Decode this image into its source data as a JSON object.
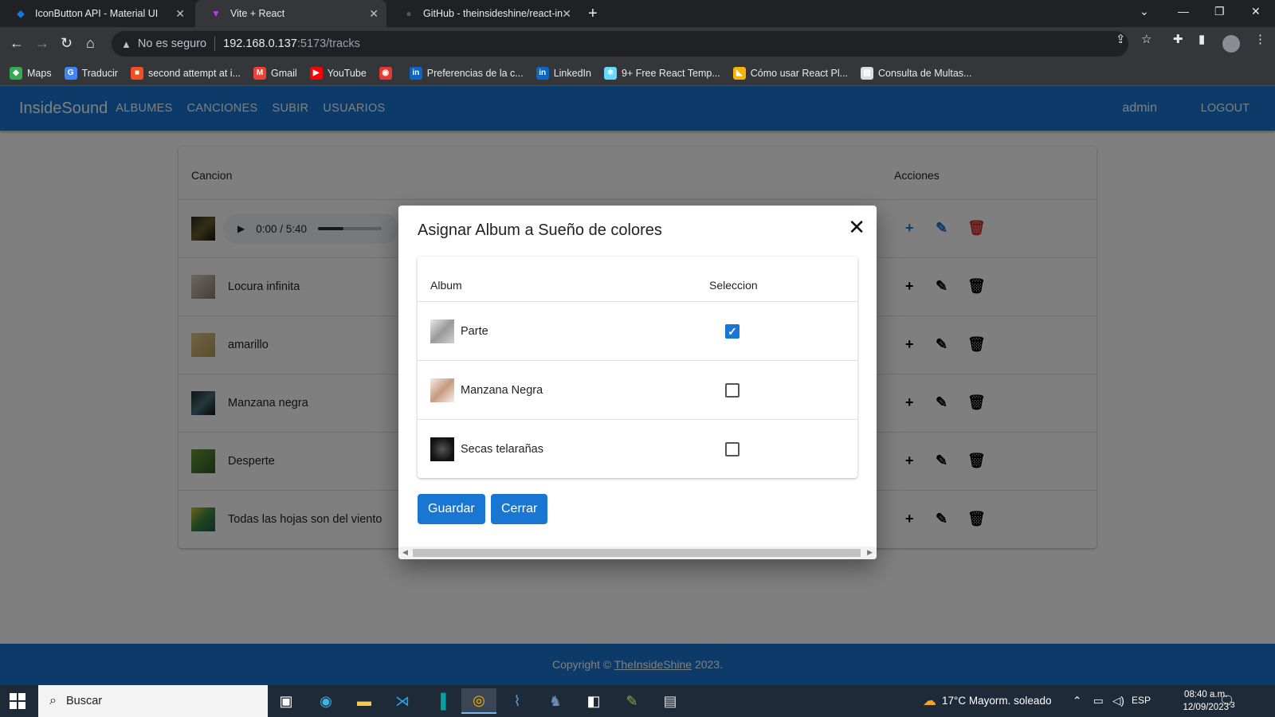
{
  "browser": {
    "tabs": [
      {
        "title": "IconButton API - Material UI",
        "icon": "mui-icon",
        "active": false
      },
      {
        "title": "Vite + React",
        "icon": "vite-icon",
        "active": true
      },
      {
        "title": "GitHub - theinsideshine/react-ins",
        "icon": "github-icon",
        "active": false
      }
    ],
    "address": {
      "warning": "No es seguro",
      "host": "192.168.0.137",
      "path": ":5173/tracks"
    },
    "bookmarks": [
      {
        "label": "Maps",
        "icon": "maps-icon",
        "color": "#34a853"
      },
      {
        "label": "Traducir",
        "icon": "translate-icon",
        "color": "#4285f4"
      },
      {
        "label": "second attempt at i...",
        "icon": "microsoft-icon",
        "color": "#f25022"
      },
      {
        "label": "Gmail",
        "icon": "gmail-icon",
        "color": "#ea4335"
      },
      {
        "label": "YouTube",
        "icon": "youtube-icon",
        "color": "#ff0000"
      },
      {
        "label": "",
        "icon": "record-icon",
        "color": "#e53935"
      },
      {
        "label": "Preferencias de la c...",
        "icon": "linkedin-icon",
        "color": "#0a66c2"
      },
      {
        "label": "LinkedIn",
        "icon": "linkedin-icon",
        "color": "#0a66c2"
      },
      {
        "label": "9+ Free React Temp...",
        "icon": "react-icon",
        "color": "#61dafb"
      },
      {
        "label": "Cómo usar React Pl...",
        "icon": "cat-icon",
        "color": "#f4b400"
      },
      {
        "label": "Consulta de Multas...",
        "icon": "document-icon",
        "color": "#dddddd"
      }
    ]
  },
  "app": {
    "brand": "InsideSound",
    "nav": [
      "ALBUMES",
      "CANCIONES",
      "SUBIR",
      "USUARIOS"
    ],
    "user": "admin",
    "logout": "LOGOUT",
    "table": {
      "headers": {
        "song": "Cancion",
        "actions": "Acciones"
      },
      "audio_time": "0:00 / 5:40",
      "rows": [
        {
          "name": "Locura infinita"
        },
        {
          "name": "amarillo"
        },
        {
          "name": "Manzana negra"
        },
        {
          "name": "Desperte"
        },
        {
          "name": "Todas las hojas son del viento"
        }
      ]
    },
    "footer": {
      "prefix": "Copyright ©",
      "link": "TheInsideShine",
      "year": "2023."
    }
  },
  "modal": {
    "title": "Asignar Album a Sueño de colores",
    "headers": {
      "album": "Album",
      "selection": "Seleccion"
    },
    "albums": [
      {
        "name": "Parte",
        "selected": true
      },
      {
        "name": "Manzana Negra",
        "selected": false
      },
      {
        "name": "Secas telarañas",
        "selected": false
      }
    ],
    "save": "Guardar",
    "close": "Cerrar"
  },
  "taskbar": {
    "search": "Buscar",
    "weather": "17°C  Mayorm. soleado",
    "lang": "ESP",
    "time": "08:40 a.m.",
    "date": "12/09/2023",
    "notifications": "3"
  }
}
